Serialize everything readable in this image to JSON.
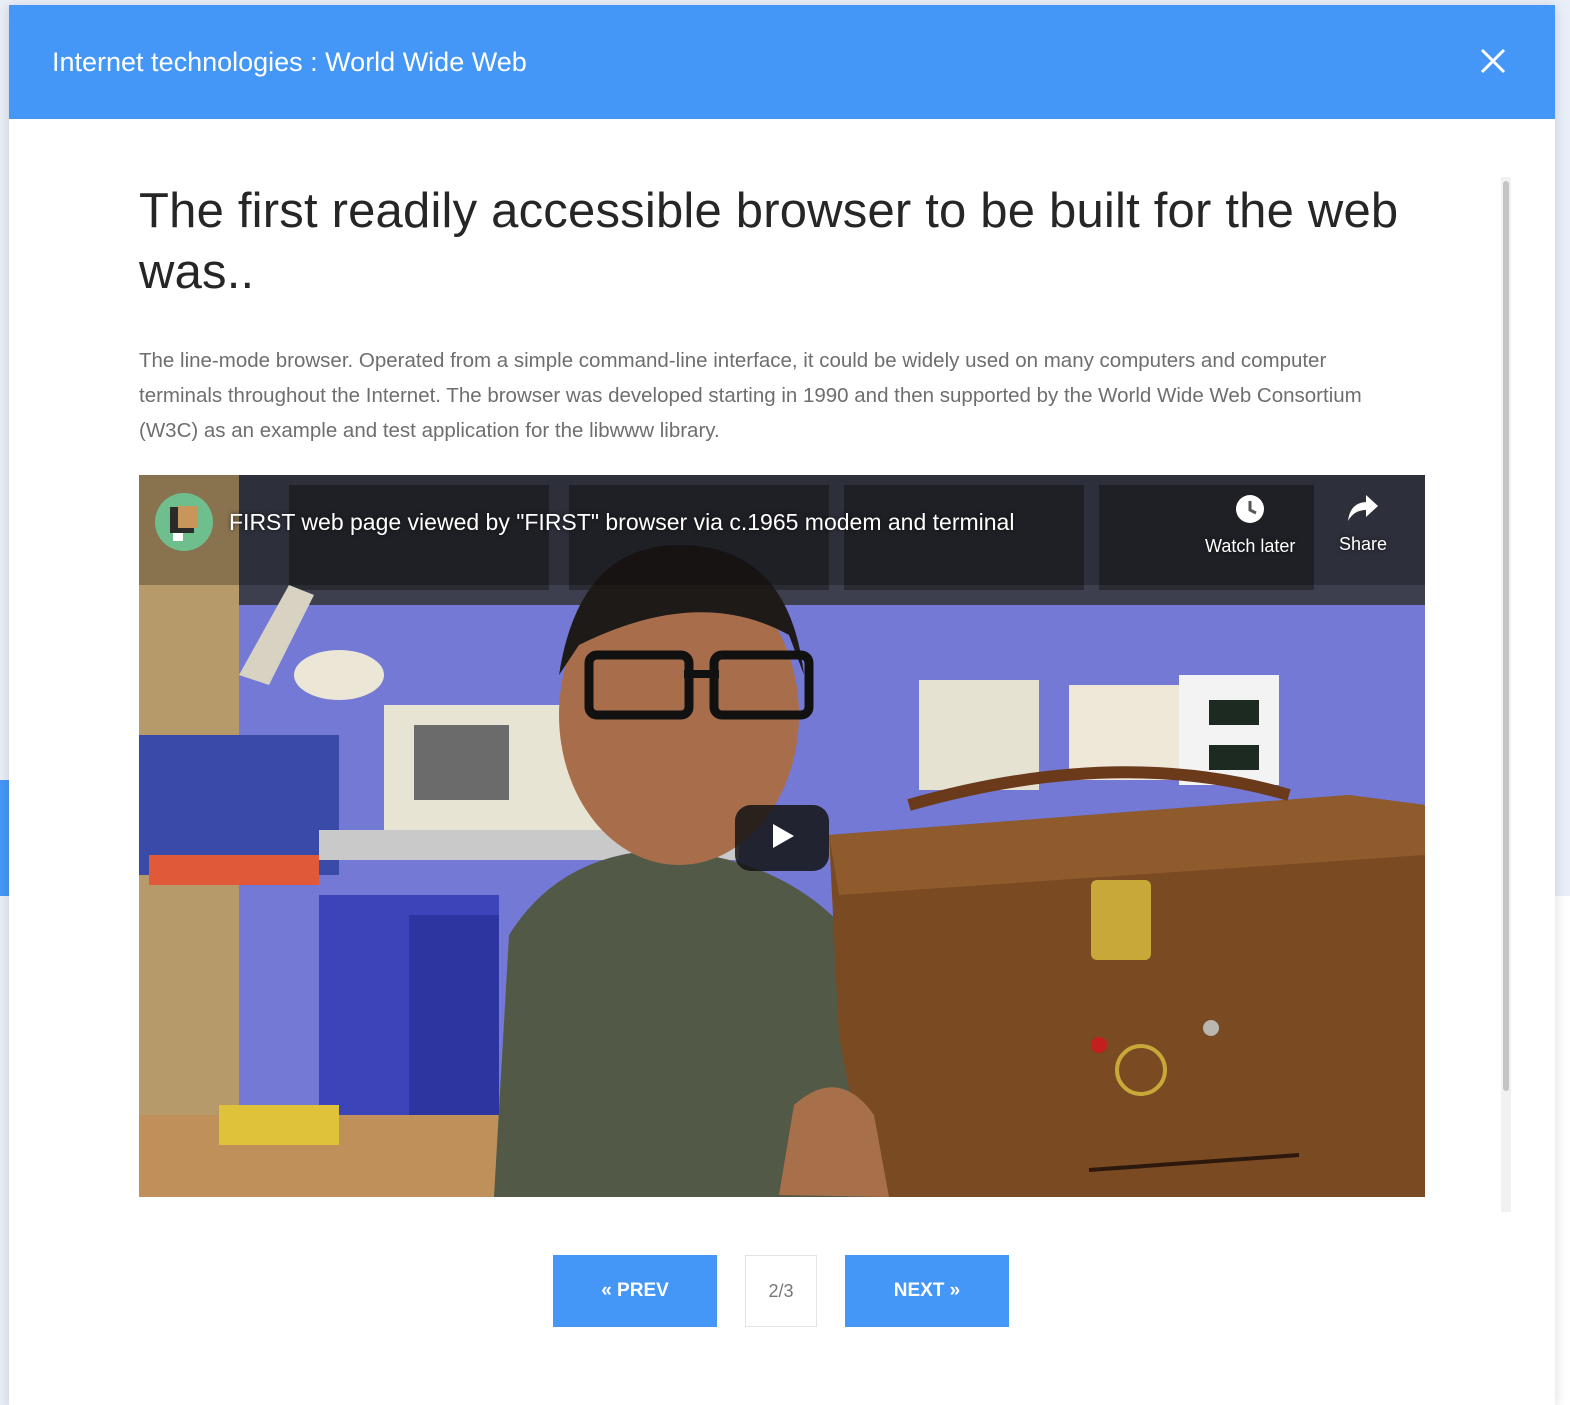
{
  "modal": {
    "title": "Internet technologies : World Wide Web",
    "question": "The first readily accessible browser to be built for the web was..",
    "answer": "The line-mode browser. Operated from a simple command-line interface, it could be widely used on many computers and computer terminals throughout the Internet. The browser was developed starting in 1990 and then supported by the World Wide Web Consortium (W3C) as an example and test application for the libwww library."
  },
  "video": {
    "title": "FIRST web page viewed by \"FIRST\" browser via c.1965 modem and terminal",
    "watch_later_label": "Watch later",
    "share_label": "Share"
  },
  "pager": {
    "prev_label": "« PREV",
    "page": "2/3",
    "next_label": "NEXT »"
  },
  "colors": {
    "accent": "#4597f7",
    "heading": "#262626",
    "body_text": "#6e6e6e"
  },
  "icons": {
    "modal_close": "close-icon",
    "side_close": "close-icon",
    "watch_later": "clock-icon",
    "share": "share-arrow-icon",
    "play": "play-icon"
  }
}
